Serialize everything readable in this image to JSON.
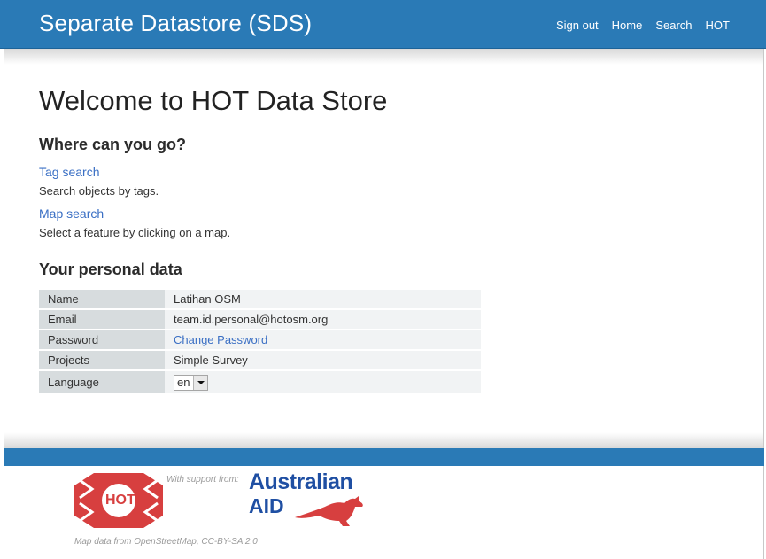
{
  "header": {
    "brand": "Separate Datastore (SDS)",
    "nav": [
      {
        "label": "Sign out"
      },
      {
        "label": "Home"
      },
      {
        "label": "Search"
      },
      {
        "label": "HOT"
      }
    ]
  },
  "main": {
    "title": "Welcome to HOT Data Store",
    "where_heading": "Where can you go?",
    "links": [
      {
        "label": "Tag search",
        "description": "Search objects by tags."
      },
      {
        "label": "Map search",
        "description": "Select a feature by clicking on a map."
      }
    ],
    "personal_heading": "Your personal data",
    "personal": {
      "name_label": "Name",
      "name_value": "Latihan OSM",
      "email_label": "Email",
      "email_value": "team.id.personal@hotosm.org",
      "password_label": "Password",
      "password_link": "Change Password",
      "projects_label": "Projects",
      "projects_value": "Simple Survey",
      "language_label": "Language",
      "language_value": "en"
    }
  },
  "footer": {
    "support_text": "With support from:",
    "hot_logo_text": "HOT",
    "ausaid_line1": "Australian",
    "ausaid_line2": "AID",
    "attribution": "Map data from OpenStreetMap, CC-BY-SA 2.0"
  },
  "colors": {
    "navbar": "#2a7ab6",
    "link": "#3a6fc4",
    "hot_red": "#d73f3f",
    "ausaid_blue": "#1f4fa3"
  }
}
